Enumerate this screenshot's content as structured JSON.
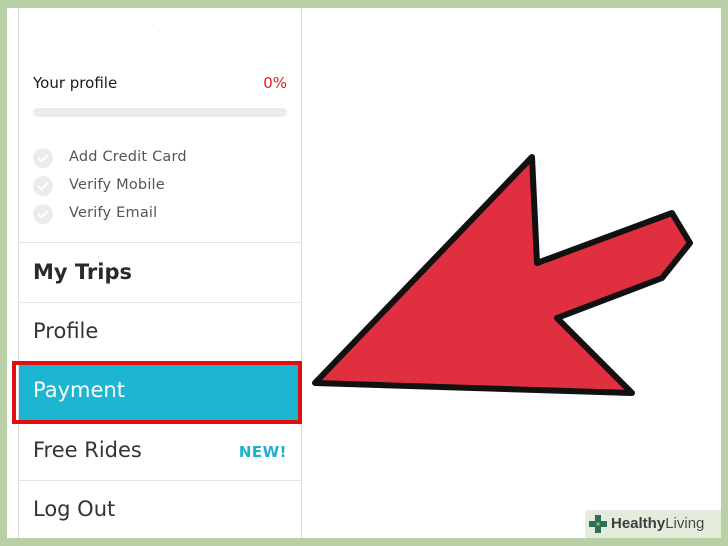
{
  "profile": {
    "label": "Your profile",
    "percent_label": "0%",
    "progress_fraction": 0,
    "checklist": [
      {
        "label": "Add Credit Card"
      },
      {
        "label": "Verify Mobile"
      },
      {
        "label": "Verify Email"
      }
    ]
  },
  "nav": {
    "my_trips": "My Trips",
    "profile": "Profile",
    "payment": "Payment",
    "free_rides": "Free Rides",
    "free_rides_badge": "NEW!",
    "log_out": "Log Out"
  },
  "watermark": {
    "brand_bold": "Healthy",
    "brand_regular": "Living"
  },
  "colors": {
    "accent": "#1cb6d3",
    "highlight": "#e01010",
    "arrow_fill": "#e03040",
    "percent_red": "#e0201c"
  },
  "icons": {
    "checklist": "check-circle-icon",
    "pointer": "red-arrow-icon",
    "watermark": "plus-logo-icon"
  }
}
